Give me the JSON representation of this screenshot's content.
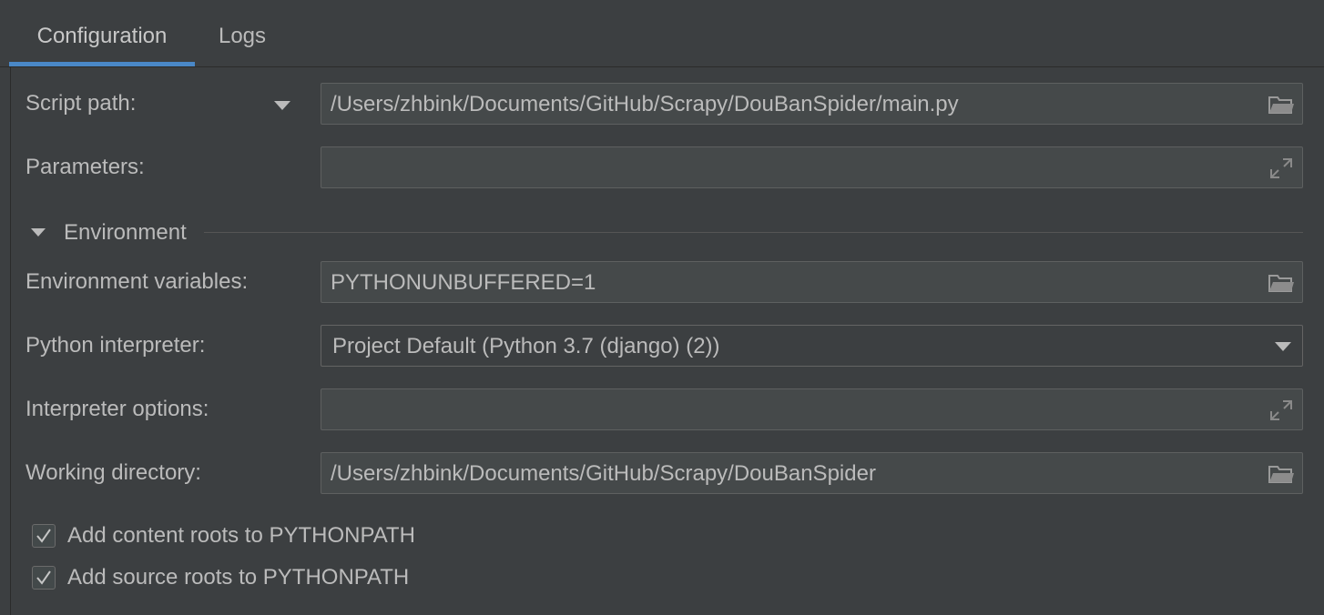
{
  "tabs": [
    {
      "label": "Configuration",
      "active": true
    },
    {
      "label": "Logs",
      "active": false
    }
  ],
  "form": {
    "script_path": {
      "label": "Script path:",
      "value": "/Users/zhbink/Documents/GitHub/Scrapy/DouBanSpider/main.py",
      "icon": "folder-icon"
    },
    "parameters": {
      "label": "Parameters:",
      "value": "",
      "icon": "expand-icon"
    },
    "environment_section": {
      "label": "Environment",
      "expanded": true
    },
    "environment_variables": {
      "label": "Environment variables:",
      "value": "PYTHONUNBUFFERED=1",
      "icon": "folder-icon"
    },
    "python_interpreter": {
      "label": "Python interpreter:",
      "value": "Project Default (Python 3.7 (django) (2))"
    },
    "interpreter_options": {
      "label": "Interpreter options:",
      "value": "",
      "icon": "expand-icon"
    },
    "working_directory": {
      "label": "Working directory:",
      "value": "/Users/zhbink/Documents/GitHub/Scrapy/DouBanSpider",
      "icon": "folder-icon"
    }
  },
  "checkboxes": [
    {
      "label": "Add content roots to PYTHONPATH",
      "checked": true
    },
    {
      "label": "Add source roots to PYTHONPATH",
      "checked": true
    }
  ],
  "colors": {
    "background": "#3c3f41",
    "field_background": "#45494a",
    "accent": "#4a88c7",
    "text": "#bbbbbb"
  }
}
